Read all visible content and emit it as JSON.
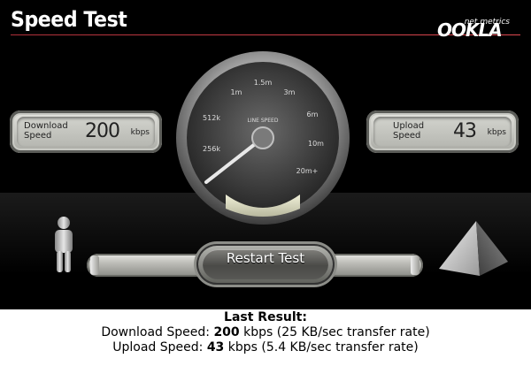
{
  "header": {
    "title": "Speed Test",
    "brand_small": "net metrics",
    "brand_main": "OOKLA"
  },
  "gauge": {
    "center_label": "LINE SPEED",
    "ticks": [
      "256k",
      "512k",
      "1m",
      "1.5m",
      "3m",
      "6m",
      "10m",
      "20m+"
    ]
  },
  "download_panel": {
    "label_line1": "Download",
    "label_line2": "Speed",
    "value": "200",
    "unit": "kbps"
  },
  "upload_panel": {
    "label_line1": "Upload",
    "label_line2": "Speed",
    "value": "43",
    "unit": "kbps"
  },
  "restart_button": {
    "label": "Restart Test"
  },
  "results": {
    "heading": "Last Result:",
    "download_label": "Download Speed:",
    "download_value": "200",
    "download_rest": "kbps (25 KB/sec transfer rate)",
    "upload_label": "Upload Speed:",
    "upload_value": "43",
    "upload_rest": "kbps (5.4 KB/sec transfer rate)"
  },
  "colors": {
    "background": "#000000",
    "accent_rule": "#c0303a"
  }
}
